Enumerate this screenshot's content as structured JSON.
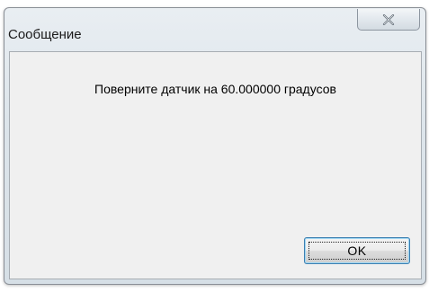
{
  "window": {
    "title": "Сообщение",
    "close_icon": "close-x-icon"
  },
  "message": {
    "text": "Поверните датчик на 60.000000 градусов"
  },
  "buttons": {
    "ok_label": "OK"
  }
}
